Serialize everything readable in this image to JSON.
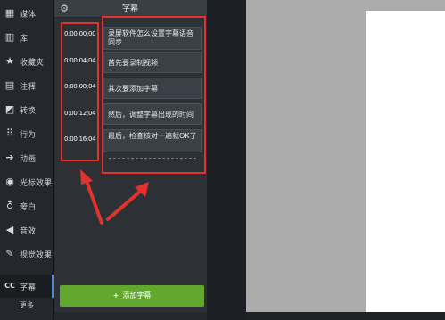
{
  "sidebar": {
    "items": [
      {
        "icon": "film-icon",
        "glyph": "▦",
        "label": "媒体"
      },
      {
        "icon": "library-icon",
        "glyph": "▥",
        "label": "库"
      },
      {
        "icon": "star-icon",
        "glyph": "★",
        "label": "收藏夹"
      },
      {
        "icon": "annotation-icon",
        "glyph": "▤",
        "label": "注释"
      },
      {
        "icon": "transition-icon",
        "glyph": "◩",
        "label": "转换"
      },
      {
        "icon": "behavior-icon",
        "glyph": "⠿",
        "label": "行为"
      },
      {
        "icon": "animation-icon",
        "glyph": "➔",
        "label": "动画"
      },
      {
        "icon": "cursor-effects-icon",
        "glyph": "◉",
        "label": "光标效果"
      },
      {
        "icon": "microphone-icon",
        "glyph": "♁",
        "label": "旁白"
      },
      {
        "icon": "audio-icon",
        "glyph": "◀",
        "label": "音效"
      },
      {
        "icon": "visual-effects-icon",
        "glyph": "✎",
        "label": "视觉效果"
      },
      {
        "icon": "captions-icon",
        "glyph": "CC",
        "label": "字幕"
      }
    ],
    "more_label": "更多"
  },
  "panel": {
    "settings_icon": "gear-icon",
    "title": "字幕",
    "captions": [
      {
        "time": "0:00:00;00",
        "text": "录屏软件怎么设置字幕语音同步"
      },
      {
        "time": "0:00:04;04",
        "text": "首先要录制视频"
      },
      {
        "time": "0:00:08;04",
        "text": "其次要添加字幕"
      },
      {
        "time": "0:00:12;04",
        "text": "然后，调整字幕出现的时间"
      },
      {
        "time": "0:00:16;04",
        "text": "最后，检查核对一遍就OK了"
      }
    ],
    "add_button": {
      "icon": "plus-icon",
      "glyph": "+",
      "label": "添加字幕"
    }
  },
  "colors": {
    "accent_green": "#62a82e",
    "highlight_red": "#e0332e",
    "active_indicator": "#4e8ad8"
  }
}
